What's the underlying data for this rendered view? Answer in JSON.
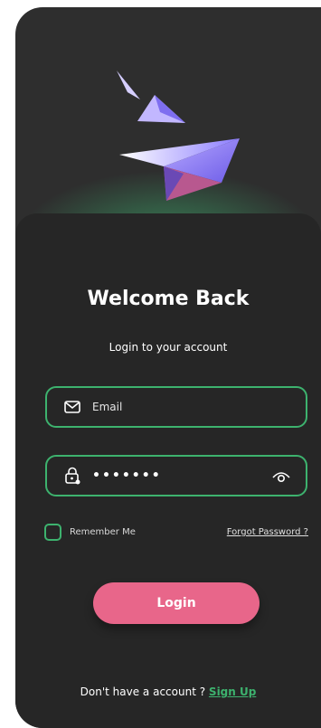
{
  "login": {
    "title": "Welcome Back",
    "subtitle": "Login to your account",
    "email": {
      "placeholder": "Email",
      "icon": "mail-icon"
    },
    "password": {
      "value": "•••••••",
      "icon": "lock-icon",
      "toggle_icon": "eye-icon"
    },
    "remember_label": "Remember Me",
    "forgot_label": "Forgot Password ?",
    "login_label": "Login",
    "signup_prompt": "Don't have a account ?",
    "signup_label": "Sign Up"
  },
  "colors": {
    "background": "#2e2e2e",
    "card": "#262626",
    "accent_green": "#3db26e",
    "button_pink": "#e8668a",
    "plane_purple": "#7b6cf0"
  }
}
